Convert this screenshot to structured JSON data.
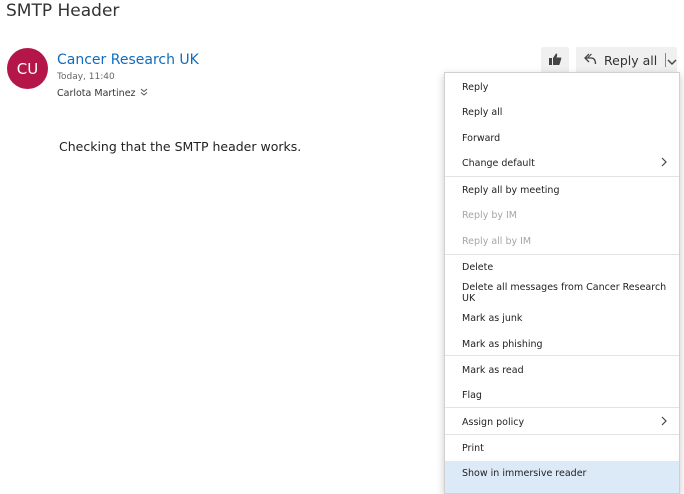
{
  "message": {
    "subject": "SMTP Header",
    "avatar_initials": "CU",
    "avatar_color": "#b5164a",
    "sender_name": "Cancer Research UK",
    "date": "Today, 11:40",
    "recipient": "Carlota Martinez",
    "body": "Checking that the SMTP header works."
  },
  "toolbar": {
    "like_icon": "thumbs-up-icon",
    "reply_all_label": "Reply all",
    "reply_icon": "reply-all-icon",
    "dropdown_icon": "chevron-down-icon"
  },
  "menu": {
    "items": [
      {
        "label": "Reply"
      },
      {
        "label": "Reply all"
      },
      {
        "label": "Forward"
      },
      {
        "label": "Change default",
        "submenu": true
      },
      {
        "label": "Reply all by meeting"
      },
      {
        "label": "Reply by IM",
        "disabled": true
      },
      {
        "label": "Reply all by IM",
        "disabled": true
      },
      {
        "label": "Delete"
      },
      {
        "label": "Delete all messages from Cancer Research UK"
      },
      {
        "label": "Mark as junk",
        "highlighted": true
      },
      {
        "label": "Mark as phishing"
      },
      {
        "label": "Mark as read"
      },
      {
        "label": "Flag"
      },
      {
        "label": "Assign policy",
        "submenu": true
      },
      {
        "label": "Print"
      },
      {
        "label": "Show in immersive reader",
        "hovered": true
      }
    ]
  },
  "colors": {
    "accent": "#0f6cbd",
    "highlighter": "#ffff33",
    "hover": "#dce9f7"
  }
}
